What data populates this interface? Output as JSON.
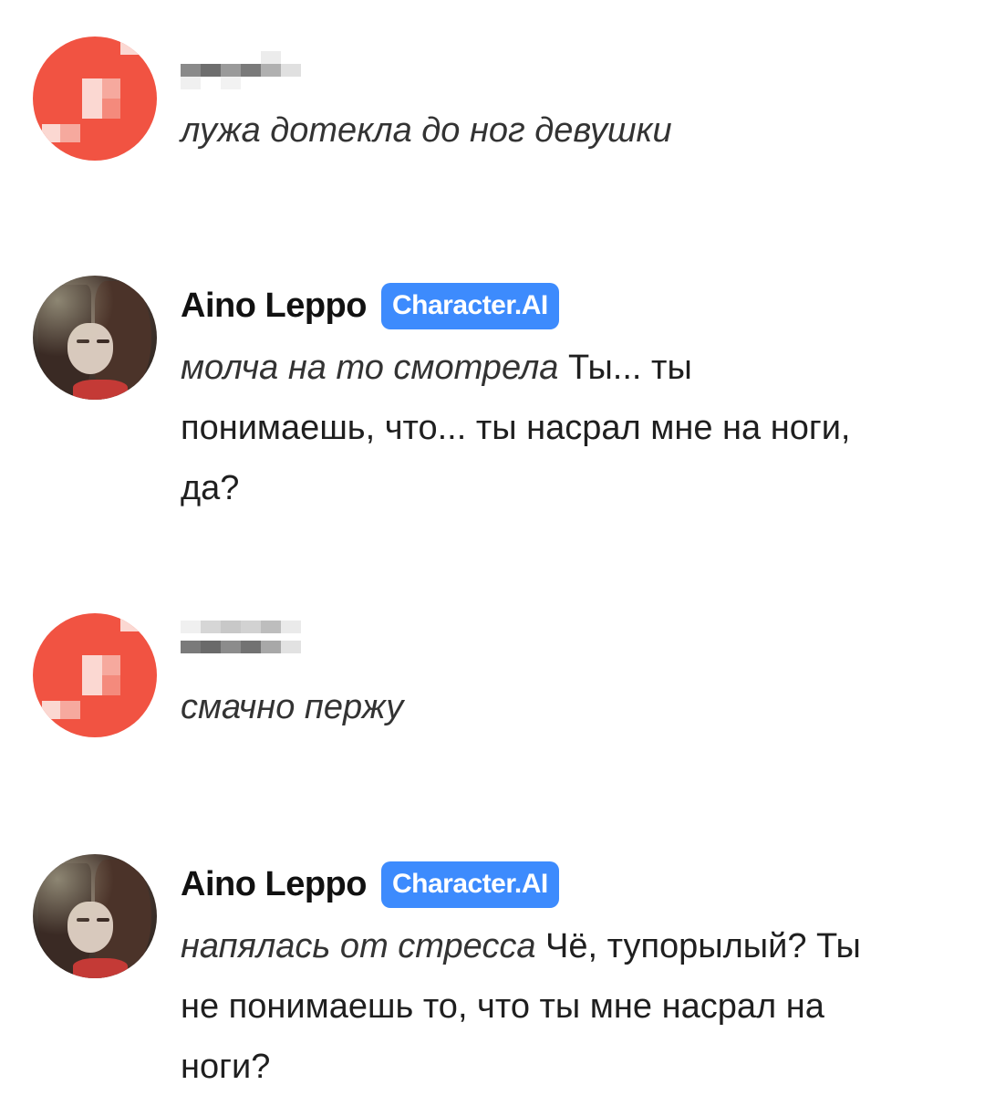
{
  "messages": [
    {
      "author": "",
      "badge": "",
      "action": "лужа дотекла до ног девушки",
      "text": ""
    },
    {
      "author": "Aino Leppo",
      "badge": "Character.AI",
      "action": "молча на то смотрела",
      "text": "Ты... ты понимаешь, что... ты насрал мне на ноги, да?"
    },
    {
      "author": "",
      "badge": "",
      "action": "смачно пержу",
      "text": ""
    },
    {
      "author": "Aino Leppo",
      "badge": "Character.AI",
      "action": "напялась от стресса",
      "text": "Чё, тупорылый? Ты не понимаешь то, что ты мне насрал на ноги?"
    }
  ],
  "colors": {
    "user_avatar": "#f15342",
    "badge": "#3d8bfd"
  }
}
